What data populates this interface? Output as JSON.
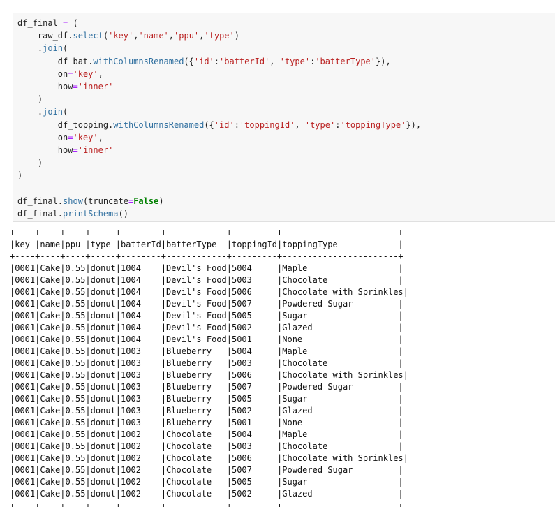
{
  "code_cell": {
    "lines": [
      [
        {
          "t": "df_final ",
          "c": "pn"
        },
        {
          "t": "=",
          "c": "op"
        },
        {
          "t": " (",
          "c": "pn"
        }
      ],
      [
        {
          "t": "    raw_df.",
          "c": "pn"
        },
        {
          "t": "select",
          "c": "fn"
        },
        {
          "t": "(",
          "c": "pn"
        },
        {
          "t": "'key'",
          "c": "str"
        },
        {
          "t": ",",
          "c": "pn"
        },
        {
          "t": "'name'",
          "c": "str"
        },
        {
          "t": ",",
          "c": "pn"
        },
        {
          "t": "'ppu'",
          "c": "str"
        },
        {
          "t": ",",
          "c": "pn"
        },
        {
          "t": "'type'",
          "c": "str"
        },
        {
          "t": ")",
          "c": "pn"
        }
      ],
      [
        {
          "t": "    .",
          "c": "pn"
        },
        {
          "t": "join",
          "c": "fn"
        },
        {
          "t": "(",
          "c": "pn"
        }
      ],
      [
        {
          "t": "        df_bat.",
          "c": "pn"
        },
        {
          "t": "withColumnsRenamed",
          "c": "fn"
        },
        {
          "t": "({",
          "c": "pn"
        },
        {
          "t": "'id'",
          "c": "str"
        },
        {
          "t": ":",
          "c": "pn"
        },
        {
          "t": "'batterId'",
          "c": "str"
        },
        {
          "t": ", ",
          "c": "pn"
        },
        {
          "t": "'type'",
          "c": "str"
        },
        {
          "t": ":",
          "c": "pn"
        },
        {
          "t": "'batterType'",
          "c": "str"
        },
        {
          "t": "}),",
          "c": "pn"
        }
      ],
      [
        {
          "t": "        on",
          "c": "pn"
        },
        {
          "t": "=",
          "c": "op"
        },
        {
          "t": "'key'",
          "c": "str"
        },
        {
          "t": ",",
          "c": "pn"
        }
      ],
      [
        {
          "t": "        how",
          "c": "pn"
        },
        {
          "t": "=",
          "c": "op"
        },
        {
          "t": "'inner'",
          "c": "str"
        }
      ],
      [
        {
          "t": "    )",
          "c": "pn"
        }
      ],
      [
        {
          "t": "    .",
          "c": "pn"
        },
        {
          "t": "join",
          "c": "fn"
        },
        {
          "t": "(",
          "c": "pn"
        }
      ],
      [
        {
          "t": "        df_topping.",
          "c": "pn"
        },
        {
          "t": "withColumnsRenamed",
          "c": "fn"
        },
        {
          "t": "({",
          "c": "pn"
        },
        {
          "t": "'id'",
          "c": "str"
        },
        {
          "t": ":",
          "c": "pn"
        },
        {
          "t": "'toppingId'",
          "c": "str"
        },
        {
          "t": ", ",
          "c": "pn"
        },
        {
          "t": "'type'",
          "c": "str"
        },
        {
          "t": ":",
          "c": "pn"
        },
        {
          "t": "'toppingType'",
          "c": "str"
        },
        {
          "t": "}),",
          "c": "pn"
        }
      ],
      [
        {
          "t": "        on",
          "c": "pn"
        },
        {
          "t": "=",
          "c": "op"
        },
        {
          "t": "'key'",
          "c": "str"
        },
        {
          "t": ",",
          "c": "pn"
        }
      ],
      [
        {
          "t": "        how",
          "c": "pn"
        },
        {
          "t": "=",
          "c": "op"
        },
        {
          "t": "'inner'",
          "c": "str"
        }
      ],
      [
        {
          "t": "    )",
          "c": "pn"
        }
      ],
      [
        {
          "t": ")",
          "c": "pn"
        }
      ],
      [
        {
          "t": "",
          "c": "pn"
        }
      ],
      [
        {
          "t": "df_final.",
          "c": "pn"
        },
        {
          "t": "show",
          "c": "fn"
        },
        {
          "t": "(truncate",
          "c": "pn"
        },
        {
          "t": "=",
          "c": "op"
        },
        {
          "t": "False",
          "c": "kw"
        },
        {
          "t": ")",
          "c": "pn"
        }
      ],
      [
        {
          "t": "df_final.",
          "c": "pn"
        },
        {
          "t": "printSchema",
          "c": "fn"
        },
        {
          "t": "()",
          "c": "pn"
        }
      ]
    ]
  },
  "output": {
    "headers": [
      "key",
      "name",
      "ppu",
      "type",
      "batterId",
      "batterType",
      "toppingId",
      "toppingType"
    ],
    "col_widths": [
      4,
      4,
      4,
      5,
      8,
      12,
      9,
      23
    ],
    "rows": [
      [
        "0001",
        "Cake",
        "0.55",
        "donut",
        "1004",
        "Devil's Food",
        "5004",
        "Maple"
      ],
      [
        "0001",
        "Cake",
        "0.55",
        "donut",
        "1004",
        "Devil's Food",
        "5003",
        "Chocolate"
      ],
      [
        "0001",
        "Cake",
        "0.55",
        "donut",
        "1004",
        "Devil's Food",
        "5006",
        "Chocolate with Sprinkles"
      ],
      [
        "0001",
        "Cake",
        "0.55",
        "donut",
        "1004",
        "Devil's Food",
        "5007",
        "Powdered Sugar"
      ],
      [
        "0001",
        "Cake",
        "0.55",
        "donut",
        "1004",
        "Devil's Food",
        "5005",
        "Sugar"
      ],
      [
        "0001",
        "Cake",
        "0.55",
        "donut",
        "1004",
        "Devil's Food",
        "5002",
        "Glazed"
      ],
      [
        "0001",
        "Cake",
        "0.55",
        "donut",
        "1004",
        "Devil's Food",
        "5001",
        "None"
      ],
      [
        "0001",
        "Cake",
        "0.55",
        "donut",
        "1003",
        "Blueberry",
        "5004",
        "Maple"
      ],
      [
        "0001",
        "Cake",
        "0.55",
        "donut",
        "1003",
        "Blueberry",
        "5003",
        "Chocolate"
      ],
      [
        "0001",
        "Cake",
        "0.55",
        "donut",
        "1003",
        "Blueberry",
        "5006",
        "Chocolate with Sprinkles"
      ],
      [
        "0001",
        "Cake",
        "0.55",
        "donut",
        "1003",
        "Blueberry",
        "5007",
        "Powdered Sugar"
      ],
      [
        "0001",
        "Cake",
        "0.55",
        "donut",
        "1003",
        "Blueberry",
        "5005",
        "Sugar"
      ],
      [
        "0001",
        "Cake",
        "0.55",
        "donut",
        "1003",
        "Blueberry",
        "5002",
        "Glazed"
      ],
      [
        "0001",
        "Cake",
        "0.55",
        "donut",
        "1003",
        "Blueberry",
        "5001",
        "None"
      ],
      [
        "0001",
        "Cake",
        "0.55",
        "donut",
        "1002",
        "Chocolate",
        "5004",
        "Maple"
      ],
      [
        "0001",
        "Cake",
        "0.55",
        "donut",
        "1002",
        "Chocolate",
        "5003",
        "Chocolate"
      ],
      [
        "0001",
        "Cake",
        "0.55",
        "donut",
        "1002",
        "Chocolate",
        "5006",
        "Chocolate with Sprinkles"
      ],
      [
        "0001",
        "Cake",
        "0.55",
        "donut",
        "1002",
        "Chocolate",
        "5007",
        "Powdered Sugar"
      ],
      [
        "0001",
        "Cake",
        "0.55",
        "donut",
        "1002",
        "Chocolate",
        "5005",
        "Sugar"
      ],
      [
        "0001",
        "Cake",
        "0.55",
        "donut",
        "1002",
        "Chocolate",
        "5002",
        "Glazed"
      ]
    ]
  },
  "colors": {
    "string": "#ba2121",
    "operator": "#aa22ff",
    "function": "#2f6f9f",
    "keyword": "#008000",
    "cell_background": "#f7f7f7"
  }
}
